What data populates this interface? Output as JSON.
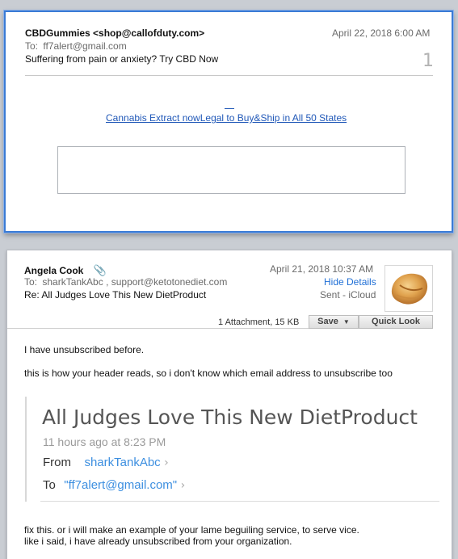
{
  "message1": {
    "sender": "CBDGummies <shop@callofduty.com>",
    "date": "April 22, 2018  6:00 AM",
    "to_label": "To:",
    "to_value": "ff7alert@gmail.com",
    "subject": "Suffering from pain or anxiety? Try CBD Now",
    "thread_count": "1",
    "link_text": "Cannabis Extract nowLegal to Buy&Ship in All 50 States"
  },
  "message2": {
    "sender": "Angela Cook",
    "date": "April 21, 2018  10:37 AM",
    "to_label": "To:",
    "to_value": "sharkTankAbc ,   support@ketotonediet.com",
    "hide_details": "Hide Details",
    "subject": "Re: All Judges Love This New DietProduct",
    "sent_via": "Sent - iCloud",
    "attachment_info": "1 Attachment, 15 KB",
    "save_label": "Save",
    "quicklook_label": "Quick Look",
    "body_line1": "I have unsubscribed before.",
    "body_line2": "this is how your header reads, so i don't know which email address to unsubscribe too",
    "quoted": {
      "title": "All Judges Love This New DietProduct",
      "time": "11 hours ago at 8:23 PM",
      "from_label": "From",
      "from_value": "sharkTankAbc",
      "to_label": "To",
      "to_value": "\"ff7alert@gmail.com\""
    },
    "body_line3": "fix this.  or i will make an example of your lame beguiling service, to serve vice.",
    "body_line4": "like i said, i have already unsubscribed from your organization."
  }
}
